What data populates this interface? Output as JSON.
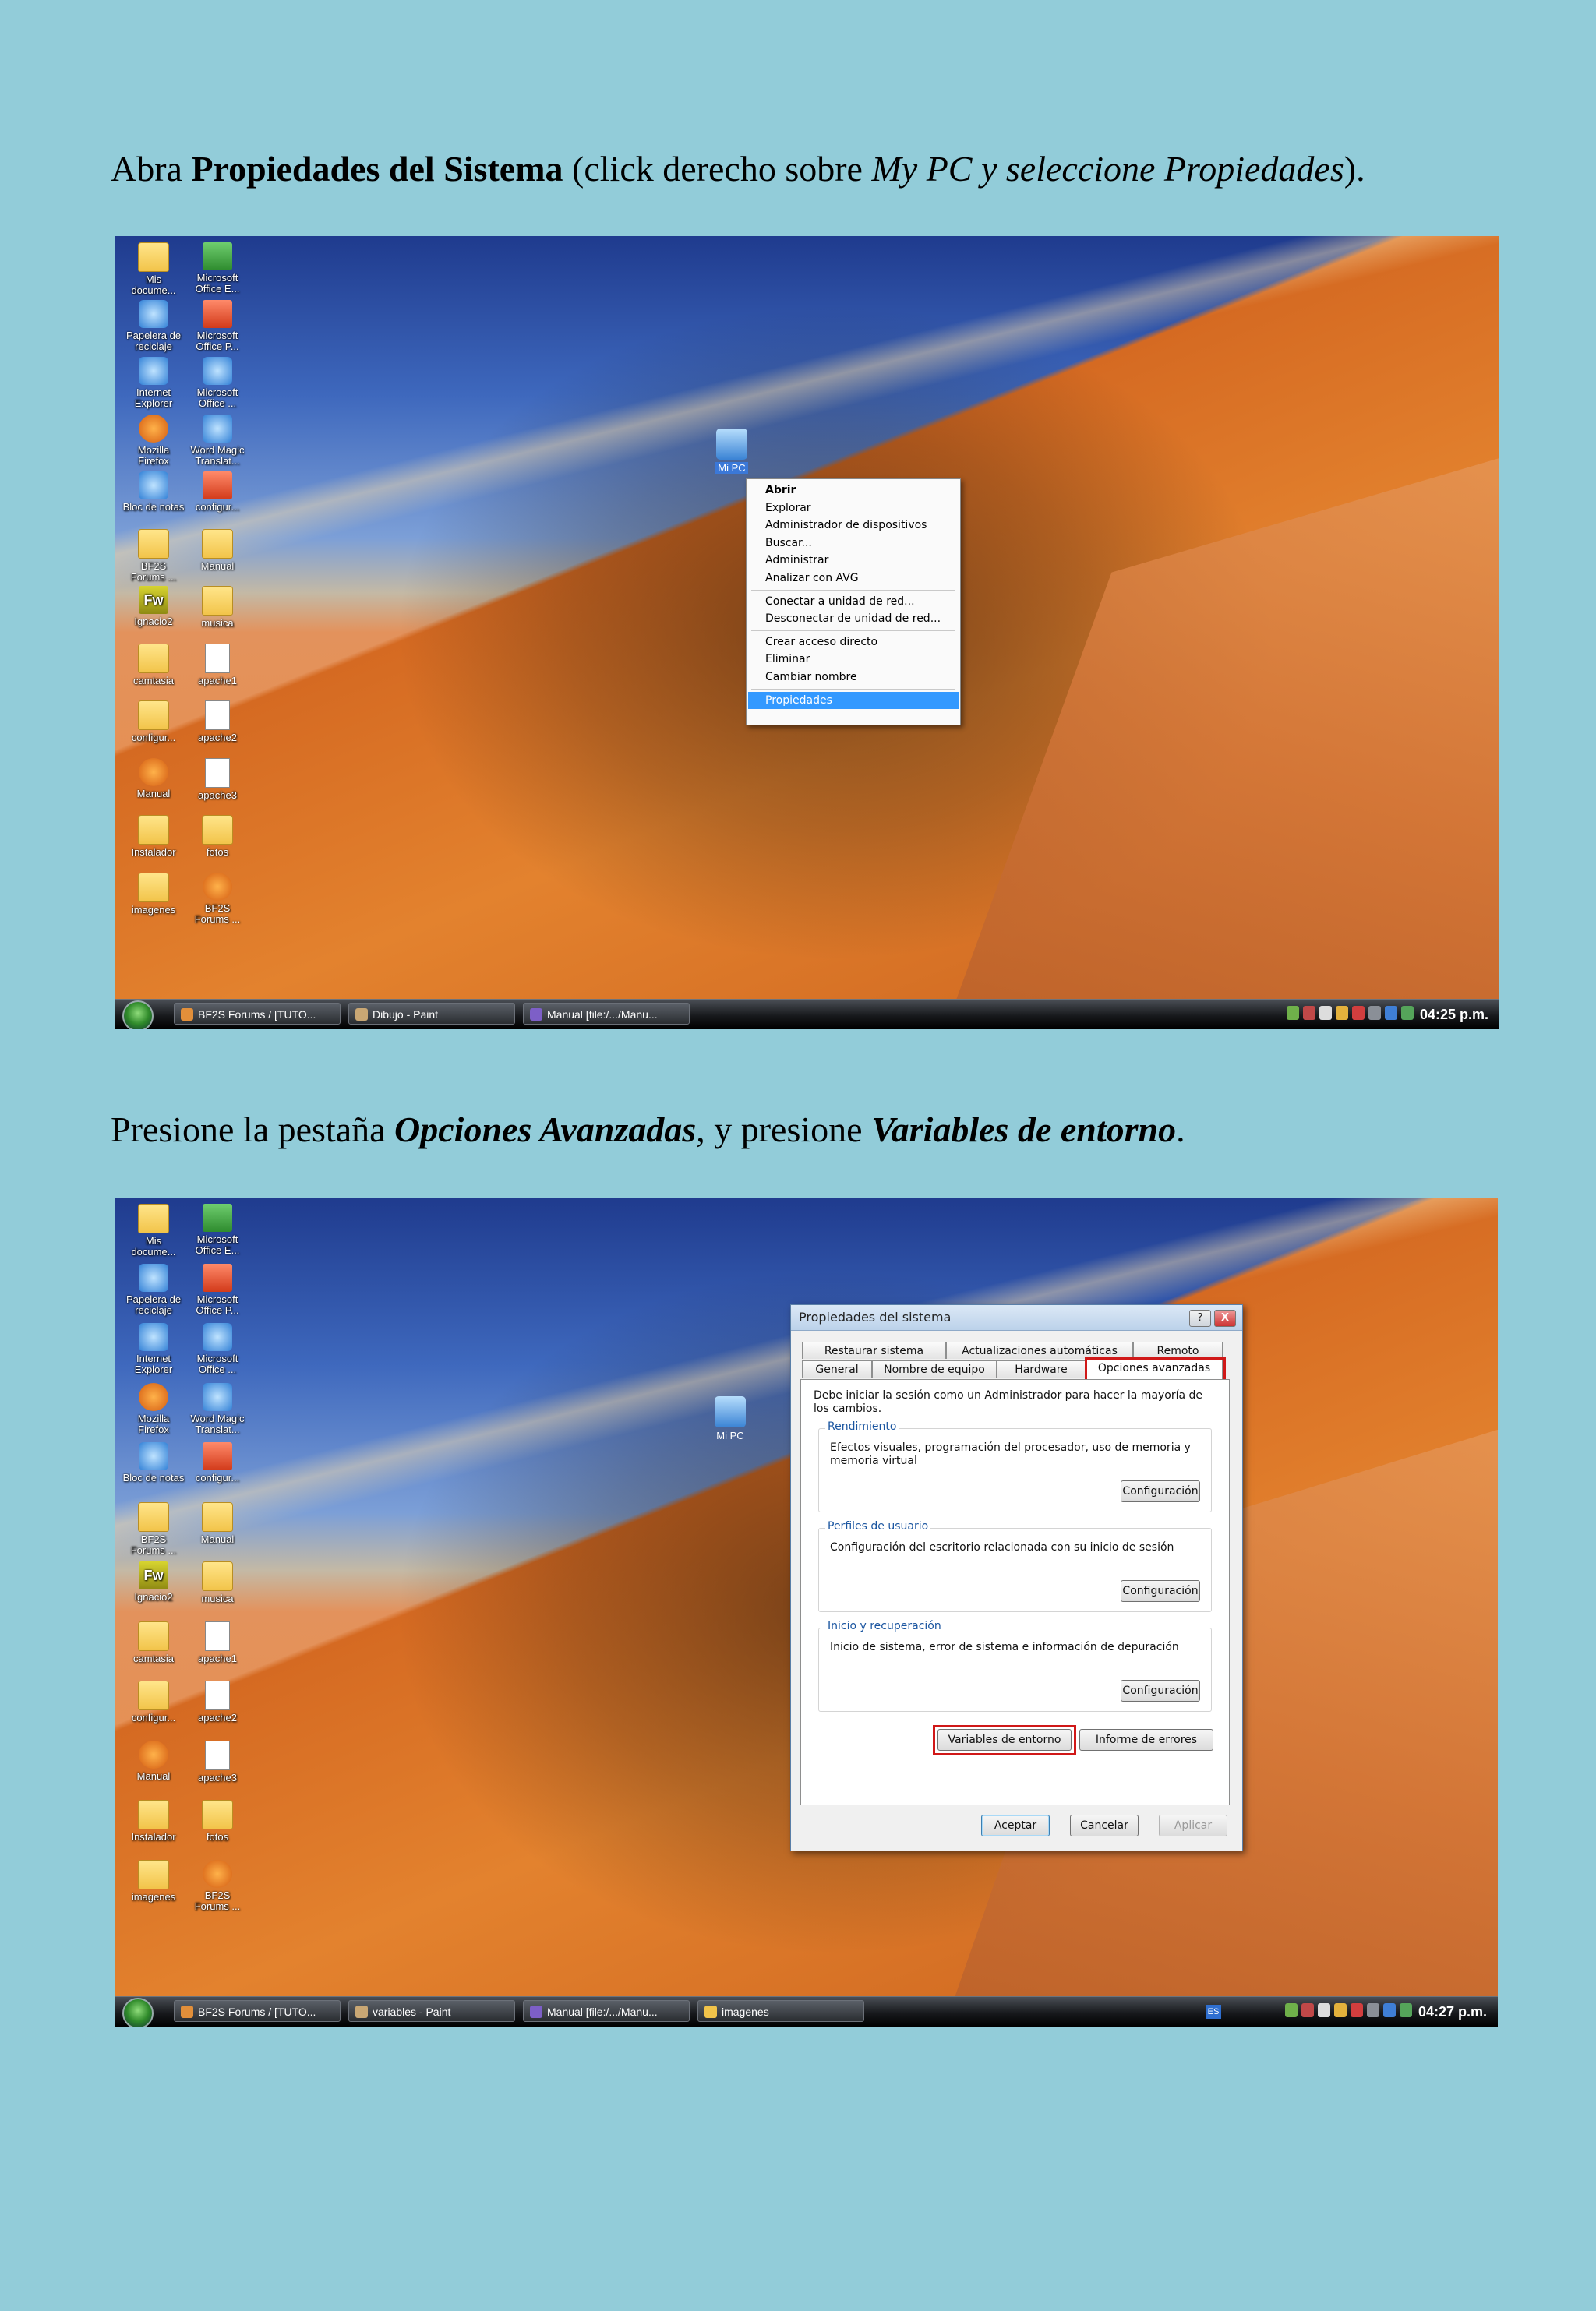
{
  "captions": {
    "c1": {
      "p1": "Abra ",
      "b1": "Propiedades del Sistema",
      "p2": " (click derecho sobre ",
      "i1": "My PC y seleccione Propiedades",
      "p3": ")."
    },
    "c2": {
      "p1": "Presione la pestaña ",
      "bi1": "Opciones Avanzadas",
      "p2": ", y presione ",
      "bi2": "Variables de entorno",
      "p3": "."
    }
  },
  "desktop_icons": {
    "left": [
      {
        "label": "Mis docume...",
        "icon": "my-documents-icon"
      },
      {
        "label": "Papelera de reciclaje",
        "icon": "recycle-bin-icon"
      },
      {
        "label": "Internet Explorer",
        "icon": "internet-explorer-icon"
      },
      {
        "label": "Mozilla Firefox",
        "icon": "firefox-icon"
      },
      {
        "label": "Bloc de notas",
        "icon": "notepad-icon"
      },
      {
        "label": "BF2S Forums ...",
        "icon": "folder-icon"
      },
      {
        "label": "Ignacio2",
        "icon": "fireworks-icon"
      },
      {
        "label": "camtasia",
        "icon": "folder-icon"
      },
      {
        "label": "configur...",
        "icon": "folder-icon"
      },
      {
        "label": "Manual",
        "icon": "firefox-icon"
      },
      {
        "label": "Instalador",
        "icon": "folder-icon"
      },
      {
        "label": "imagenes",
        "icon": "folder-icon"
      }
    ],
    "right": [
      {
        "label": "Microsoft Office E...",
        "icon": "excel-icon"
      },
      {
        "label": "Microsoft Office P...",
        "icon": "powerpoint-icon"
      },
      {
        "label": "Microsoft Office ...",
        "icon": "word-icon"
      },
      {
        "label": "Word Magic Translat...",
        "icon": "word-magic-icon"
      },
      {
        "label": "configur...",
        "icon": "winrar-icon"
      },
      {
        "label": "Manual",
        "icon": "folder-icon"
      },
      {
        "label": "musica",
        "icon": "folder-icon"
      },
      {
        "label": "apache1",
        "icon": "document-icon"
      },
      {
        "label": "apache2",
        "icon": "document-icon"
      },
      {
        "label": "apache3",
        "icon": "document-icon"
      },
      {
        "label": "fotos",
        "icon": "folder-icon"
      },
      {
        "label": "BF2S Forums ...",
        "icon": "firefox-icon"
      }
    ]
  },
  "screenshot1": {
    "mypc_label": "Mi PC",
    "context_menu": [
      "Abrir",
      "Explorar",
      "Administrador de dispositivos",
      "Buscar...",
      "Administrar",
      "Analizar con AVG",
      "Conectar a unidad de red...",
      "Desconectar de unidad de red...",
      "Crear acceso directo",
      "Eliminar",
      "Cambiar nombre",
      "Propiedades"
    ],
    "taskbar": [
      "BF2S Forums / [TUTO...",
      "Dibujo - Paint",
      "Manual [file:/.../Manu..."
    ],
    "clock": "04:25 p.m."
  },
  "screenshot2": {
    "mypc_label": "Mi PC",
    "dialog": {
      "title": "Propiedades del sistema",
      "help_glyph": "?",
      "close_glyph": "X",
      "tabs_row1": [
        "Restaurar sistema",
        "Actualizaciones automáticas",
        "Remoto"
      ],
      "tabs_row2": [
        "General",
        "Nombre de equipo",
        "Hardware",
        "Opciones avanzadas"
      ],
      "message": "Debe iniciar la sesión como un Administrador para hacer la mayoría de los cambios.",
      "groups": [
        {
          "title": "Rendimiento",
          "desc": "Efectos visuales, programación del procesador, uso de memoria y memoria virtual",
          "button": "Configuración"
        },
        {
          "title": "Perfiles de usuario",
          "desc": "Configuración del escritorio relacionada con su inicio de sesión",
          "button": "Configuración"
        },
        {
          "title": "Inicio y recuperación",
          "desc": "Inicio de sistema, error de sistema e información de depuración",
          "button": "Configuración"
        }
      ],
      "env_button": "Variables de entorno",
      "errors_button": "Informe de errores",
      "ok": "Aceptar",
      "cancel": "Cancelar",
      "apply": "Aplicar"
    },
    "taskbar": [
      "BF2S Forums / [TUTO...",
      "variables - Paint",
      "Manual [file:/.../Manu...",
      "imagenes"
    ],
    "lang": "ES",
    "clock": "04:27 p.m."
  },
  "colors": {
    "page_bg": "#92ccd9",
    "highlight": "#3399ff",
    "annotation_red": "#d01818"
  }
}
